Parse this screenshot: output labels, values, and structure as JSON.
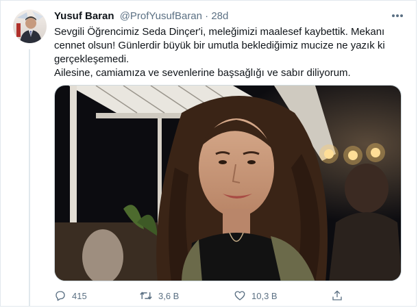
{
  "tweet": {
    "author_name": "Yusuf Baran",
    "author_handle": "@ProfYusufBaran",
    "separator": "·",
    "timestamp": "28d",
    "text_lines": [
      "Sevgili Öğrencimiz Seda Dinçer'i, meleğimizi maalesef kaybettik. Mekanı cennet olsun! Günlerdir büyük bir umutla beklediğimiz mucize ne yazık ki gerçekleşemedi.",
      "Ailesine, camiamıza ve sevenlerine başsağlığı ve sabır diliyorum."
    ],
    "media": {
      "type": "photo"
    }
  },
  "actions": {
    "reply": {
      "icon": "reply-icon",
      "count": "415"
    },
    "retweet": {
      "icon": "retweet-icon",
      "count": "3,6 B"
    },
    "like": {
      "icon": "heart-icon",
      "count": "10,3 B"
    },
    "share": {
      "icon": "share-icon"
    }
  },
  "more_menu": {
    "icon": "more-dots-icon"
  },
  "colors": {
    "text_primary": "#0f1419",
    "text_secondary": "#5b7083",
    "border": "#e1e8ed",
    "icon": "#5b7083"
  }
}
